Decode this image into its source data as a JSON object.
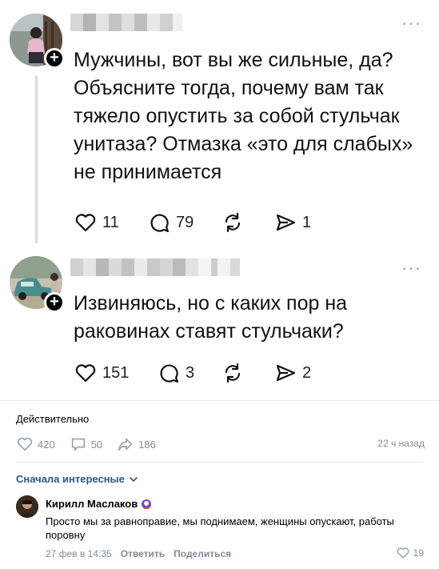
{
  "threads": {
    "post1": {
      "text_lines": [
        "Мужчины, вот вы же сильные, да?",
        "Объясните тогда, почему вам так",
        "тяжело опустить за собой стульчак",
        "унитаза? Отмазка «это для слабых»",
        "не принимается"
      ],
      "likes": "11",
      "replies": "79",
      "shares": "1",
      "more_icon": "more-dots-icon"
    },
    "post2": {
      "text_lines": [
        "Извиняюсь, но с каких пор на",
        "раковинах ставят стульчаки?"
      ],
      "likes": "151",
      "replies": "3",
      "shares": "2",
      "more_icon": "more-dots-icon"
    },
    "icons": [
      "heart-icon",
      "comment-bubble-icon",
      "repost-icon",
      "send-icon",
      "plus-icon"
    ]
  },
  "vk": {
    "caption": "Действительно",
    "likes": "420",
    "comments": "50",
    "shares": "186",
    "time": "22 ч назад",
    "sort_label": "Сначала интересные",
    "comment": {
      "author": "Кирилл Маслаков",
      "text": "Просто мы за равноправие, мы поднимаем, женщины опускают, работы поровну",
      "date": "27 фев в 14:35",
      "reply": "Ответить",
      "share": "Поделиться",
      "likes": "19"
    },
    "colors": {
      "link": "#2a5885",
      "muted": "#818c99",
      "divider": "#e7e8ec"
    }
  }
}
